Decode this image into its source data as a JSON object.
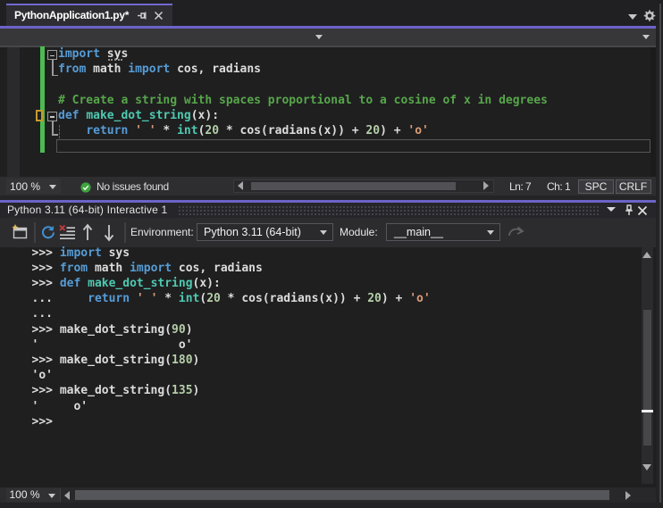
{
  "accent_color": "#6C63C8",
  "tab_strip": {
    "tab": {
      "title": "PythonApplication1.py*"
    }
  },
  "editor": {
    "lines": [
      [
        [
          "kw",
          "import"
        ],
        [
          "id",
          " "
        ],
        [
          "sug",
          "sys"
        ]
      ],
      [
        [
          "kw",
          "from"
        ],
        [
          "id",
          " math "
        ],
        [
          "kw",
          "import"
        ],
        [
          "id",
          " cos, radians"
        ]
      ],
      [],
      [
        [
          "com",
          "# Create a string with spaces proportional to a cosine of x in degrees"
        ]
      ],
      [
        [
          "kw",
          "def"
        ],
        [
          "id",
          " "
        ],
        [
          "fn",
          "make_dot_string"
        ],
        [
          "id",
          "(x):"
        ]
      ],
      [
        [
          "id",
          "    "
        ],
        [
          "kw",
          "return"
        ],
        [
          "id",
          " "
        ],
        [
          "str",
          "' '"
        ],
        [
          "id",
          " * "
        ],
        [
          "fn",
          "int"
        ],
        [
          "id",
          "("
        ],
        [
          "num",
          "20"
        ],
        [
          "id",
          " * cos(radians(x)) + "
        ],
        [
          "num",
          "20"
        ],
        [
          "id",
          ") + "
        ],
        [
          "str",
          "'o'"
        ]
      ]
    ]
  },
  "editor_status": {
    "zoom": "100 %",
    "message": "No issues found",
    "line": "Ln: 7",
    "column": "Ch: 1",
    "spaces": "SPC",
    "line_ending": "CRLF"
  },
  "interactive": {
    "title": "Python 3.11 (64-bit) Interactive 1",
    "toolbar": {
      "environment_label": "Environment:",
      "environment_value": "Python 3.11 (64-bit)",
      "module_label": "Module:",
      "module_value": "__main__"
    },
    "lines": [
      [
        [
          "prompt",
          ">>> "
        ],
        [
          "kw",
          "import"
        ],
        [
          "id",
          " sys"
        ]
      ],
      [
        [
          "prompt",
          ">>> "
        ],
        [
          "kw",
          "from"
        ],
        [
          "id",
          " math "
        ],
        [
          "kw",
          "import"
        ],
        [
          "id",
          " cos, radians"
        ]
      ],
      [
        [
          "prompt",
          ">>> "
        ],
        [
          "kw",
          "def"
        ],
        [
          "id",
          " "
        ],
        [
          "fn",
          "make_dot_string"
        ],
        [
          "id",
          "(x):"
        ]
      ],
      [
        [
          "prompt",
          "... "
        ],
        [
          "id",
          "    "
        ],
        [
          "kw",
          "return"
        ],
        [
          "id",
          " "
        ],
        [
          "str",
          "' '"
        ],
        [
          "id",
          " * "
        ],
        [
          "fn",
          "int"
        ],
        [
          "id",
          "("
        ],
        [
          "num",
          "20"
        ],
        [
          "id",
          " * cos(radians(x)) + "
        ],
        [
          "num",
          "20"
        ],
        [
          "id",
          ") + "
        ],
        [
          "str",
          "'o'"
        ]
      ],
      [
        [
          "prompt",
          "..."
        ]
      ],
      [
        [
          "prompt",
          ">>> "
        ],
        [
          "id",
          "make_dot_string("
        ],
        [
          "num",
          "90"
        ],
        [
          "id",
          ")"
        ]
      ],
      [
        [
          "id",
          "'                    o'"
        ]
      ],
      [
        [
          "prompt",
          ">>> "
        ],
        [
          "id",
          "make_dot_string("
        ],
        [
          "num",
          "180"
        ],
        [
          "id",
          ")"
        ]
      ],
      [
        [
          "id",
          "'o'"
        ]
      ],
      [
        [
          "prompt",
          ">>> "
        ],
        [
          "id",
          "make_dot_string("
        ],
        [
          "num",
          "135"
        ],
        [
          "id",
          ")"
        ]
      ],
      [
        [
          "id",
          "'     o'"
        ]
      ],
      [
        [
          "prompt",
          ">>>"
        ]
      ]
    ],
    "zoom": "100 %"
  }
}
